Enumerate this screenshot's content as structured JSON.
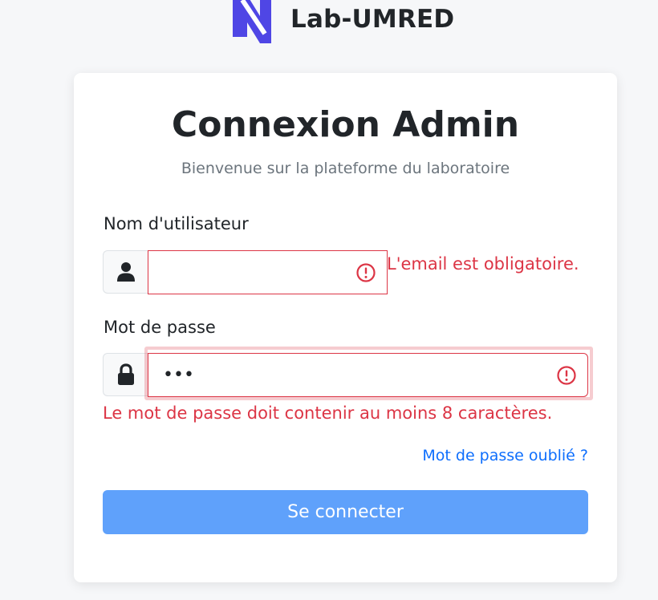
{
  "brand": {
    "name": "Lab-UMRED",
    "logo_icon": "lab-umred-logo",
    "logo_color": "#4f46e5"
  },
  "login": {
    "title": "Connexion Admin",
    "subtitle": "Bienvenue sur la plateforme du laboratoire",
    "username": {
      "label": "Nom d'utilisateur",
      "icon": "user-icon",
      "value": "",
      "error": "L'email est obligatoire."
    },
    "password": {
      "label": "Mot de passe",
      "icon": "lock-icon",
      "value": "•••",
      "error": "Le mot de passe doit contenir au moins 8 caractères."
    },
    "forgot_label": "Mot de passe oublié ?",
    "submit_label": "Se connecter"
  },
  "colors": {
    "error": "#dc3545",
    "link": "#0d6efd",
    "button": "#5fa1fb"
  }
}
